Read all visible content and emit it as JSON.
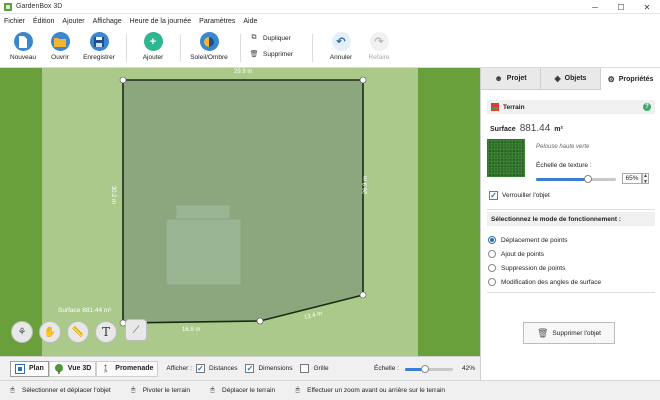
{
  "window": {
    "title": "GardenBox 3D"
  },
  "menu": [
    "Fichier",
    "Édition",
    "Ajouter",
    "Affichage",
    "Heure de la journée",
    "Paramètres",
    "Aide"
  ],
  "toolbar": {
    "nouveau": "Nouveau",
    "ouvrir": "Ouvrir",
    "enregistrer": "Enregistrer",
    "ajouter": "Ajouter",
    "soleil": "Soleil/Ombre",
    "dupliquer": "Dupliquer",
    "supprimer": "Supprimer",
    "annuler": "Annuler",
    "refaire": "Refaire"
  },
  "canvas": {
    "dim_top": "29.9 m",
    "dim_left": "30.2 m",
    "dim_right": "26.9 m",
    "dim_bottom": "16.9 m",
    "dim_diag": "13.4 m",
    "surface_label": "Surface 881.44  m²",
    "colors": {
      "lawn": "#aac98a",
      "outer_grass": "#6aa03c",
      "plot_fill": "#8ca77d",
      "house": "#99b490"
    }
  },
  "viewbar": {
    "plan": "Plan",
    "vue3d": "Vue 3D",
    "promenade": "Promenade",
    "afficher": "Afficher :",
    "distances": "Distances",
    "dimensions": "Dimensions",
    "grille": "Grille",
    "echelle": "Échelle :",
    "scale_value": "42%",
    "scale_fraction": 0.42,
    "distances_checked": true,
    "dimensions_checked": true,
    "grille_checked": false
  },
  "status": {
    "s1": "Sélectionner et déplacer l'objet",
    "s2": "Pivoter le terrain",
    "s3": "Déplacer le terrain",
    "s4": "Effectuer un zoom avant ou arrière sur le terrain"
  },
  "panel": {
    "tabs": [
      "Projet",
      "Objets",
      "Propriétés"
    ],
    "active_tab": "Propriétés",
    "section_title": "Terrain",
    "help": "?",
    "surface_label": "Surface",
    "surface_value": "881.44",
    "surface_unit": "m²",
    "texture_name": "Pelouse haute verte",
    "texture_scale_label": "Échelle de texture :",
    "texture_scale_value": "65%",
    "texture_scale_fraction": 0.65,
    "lock_label": "Verrouiller l'objet",
    "lock_checked": true,
    "mode_title": "Sélectionnez le mode de fonctionnement :",
    "modes": [
      "Déplacement de points",
      "Ajout de points",
      "Suppression de points",
      "Modification des angles de surface"
    ],
    "selected_mode": 0,
    "delete_button": "Supprimer l'objet"
  }
}
